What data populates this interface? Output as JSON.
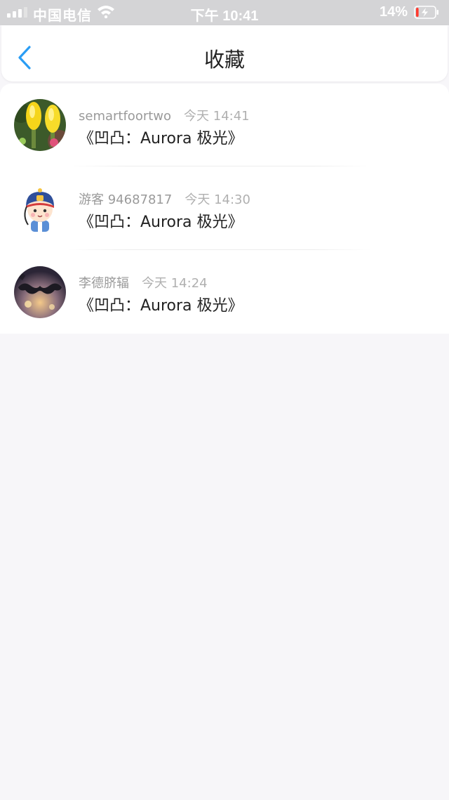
{
  "status_bar": {
    "carrier": "中国电信",
    "time": "下午 10:41",
    "battery_percent": "14%",
    "signal_icon": "signal-icon",
    "wifi_icon": "wifi-icon",
    "battery_icon": "battery-charging-icon",
    "battery_level": 0.14,
    "battery_color": "#ff3b30"
  },
  "nav": {
    "back_icon": "chevron-left-icon",
    "title": "收藏",
    "accent": "#2a9df4"
  },
  "favorites": [
    {
      "user": "semartfoortwo",
      "time": "今天 14:41",
      "content": "《凹凸：Aurora 极光》",
      "avatar": "cactus-flower-avatar"
    },
    {
      "user": "游客 94687817",
      "time": "今天 14:30",
      "content": "《凹凸：Aurora 极光》",
      "avatar": "cartoon-child-avatar"
    },
    {
      "user": "李德脐辐",
      "time": "今天 14:24",
      "content": "《凹凸：Aurora 极光》",
      "avatar": "mustache-avatar"
    }
  ]
}
